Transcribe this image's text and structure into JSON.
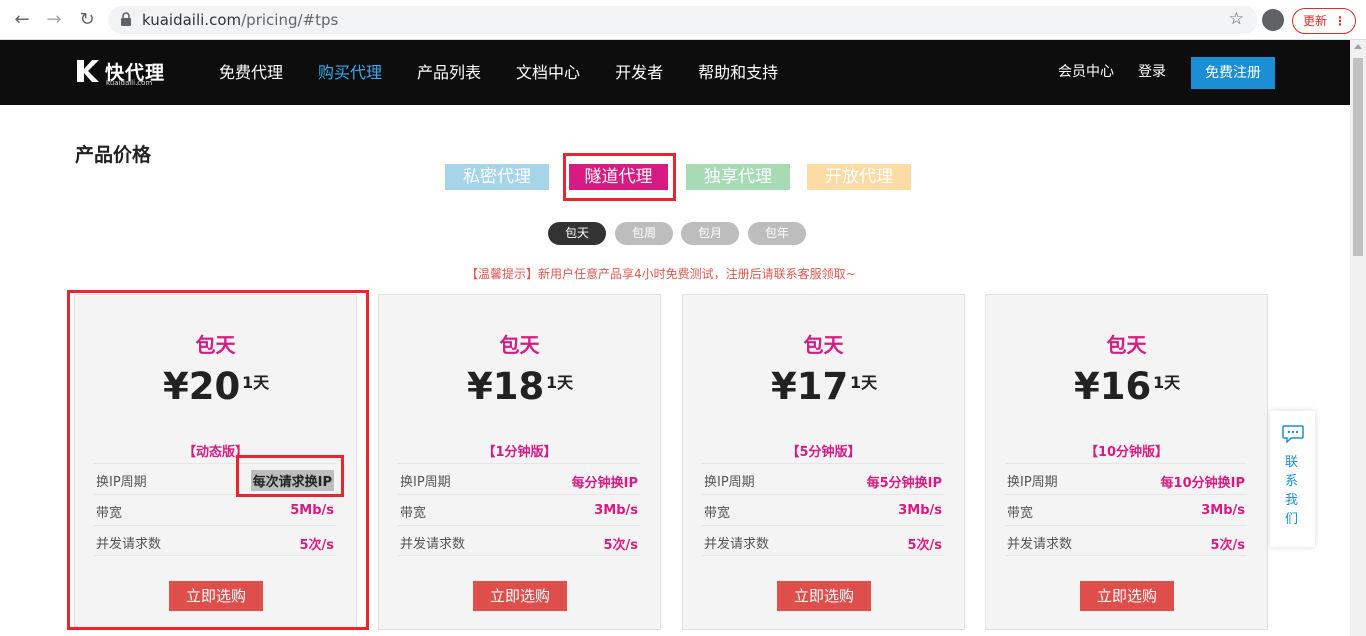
{
  "browser": {
    "url_host": "kuaidaili.com",
    "url_path": "/pricing/#tps",
    "update_label": "更新",
    "update_dots": "⋮",
    "nav_back": "←",
    "nav_forward": "→",
    "nav_reload": "↻",
    "star": "☆"
  },
  "header": {
    "logo_text": "快代理",
    "logo_sub": "kuaidaili.com",
    "nav": [
      "免费代理",
      "购买代理",
      "产品列表",
      "文档中心",
      "开发者",
      "帮助和支持"
    ],
    "active_nav": "购买代理",
    "member": "会员中心",
    "login": "登录",
    "register": "免费注册",
    "accent_color": "#3ba8ef"
  },
  "content": {
    "section_title": "产品价格",
    "product_tabs": [
      "私密代理",
      "隧道代理",
      "独享代理",
      "开放代理"
    ],
    "selected_product_tab": "隧道代理",
    "period_tabs": [
      "包天",
      "包周",
      "包月",
      "包年"
    ],
    "selected_period": "包天",
    "tip": "【温馨提示】新用户任意产品享4小时免费测试，注册后请联系客服领取~",
    "cards": [
      {
        "plan": "包天",
        "price": "¥20",
        "unit": "1天",
        "version": "【动态版】",
        "rows": [
          [
            "换IP周期",
            "每次请求换IP"
          ],
          [
            "带宽",
            "5Mb/s"
          ],
          [
            "并发请求数",
            "5次/s"
          ]
        ],
        "button": "立即选购"
      },
      {
        "plan": "包天",
        "price": "¥18",
        "unit": "1天",
        "version": "【1分钟版】",
        "rows": [
          [
            "换IP周期",
            "每分钟换IP"
          ],
          [
            "带宽",
            "3Mb/s"
          ],
          [
            "并发请求数",
            "5次/s"
          ]
        ],
        "button": "立即选购"
      },
      {
        "plan": "包天",
        "price": "¥17",
        "unit": "1天",
        "version": "【5分钟版】",
        "rows": [
          [
            "换IP周期",
            "每5分钟换IP"
          ],
          [
            "带宽",
            "3Mb/s"
          ],
          [
            "并发请求数",
            "5次/s"
          ]
        ],
        "button": "立即选购"
      },
      {
        "plan": "包天",
        "price": "¥16",
        "unit": "1天",
        "version": "【10分钟版】",
        "rows": [
          [
            "换IP周期",
            "每10分钟换IP"
          ],
          [
            "带宽",
            "3Mb/s"
          ],
          [
            "并发请求数",
            "5次/s"
          ]
        ],
        "button": "立即选购"
      }
    ],
    "contact": "联系我们",
    "brand_pink": "#d81b82",
    "button_red": "#de4f4c"
  }
}
